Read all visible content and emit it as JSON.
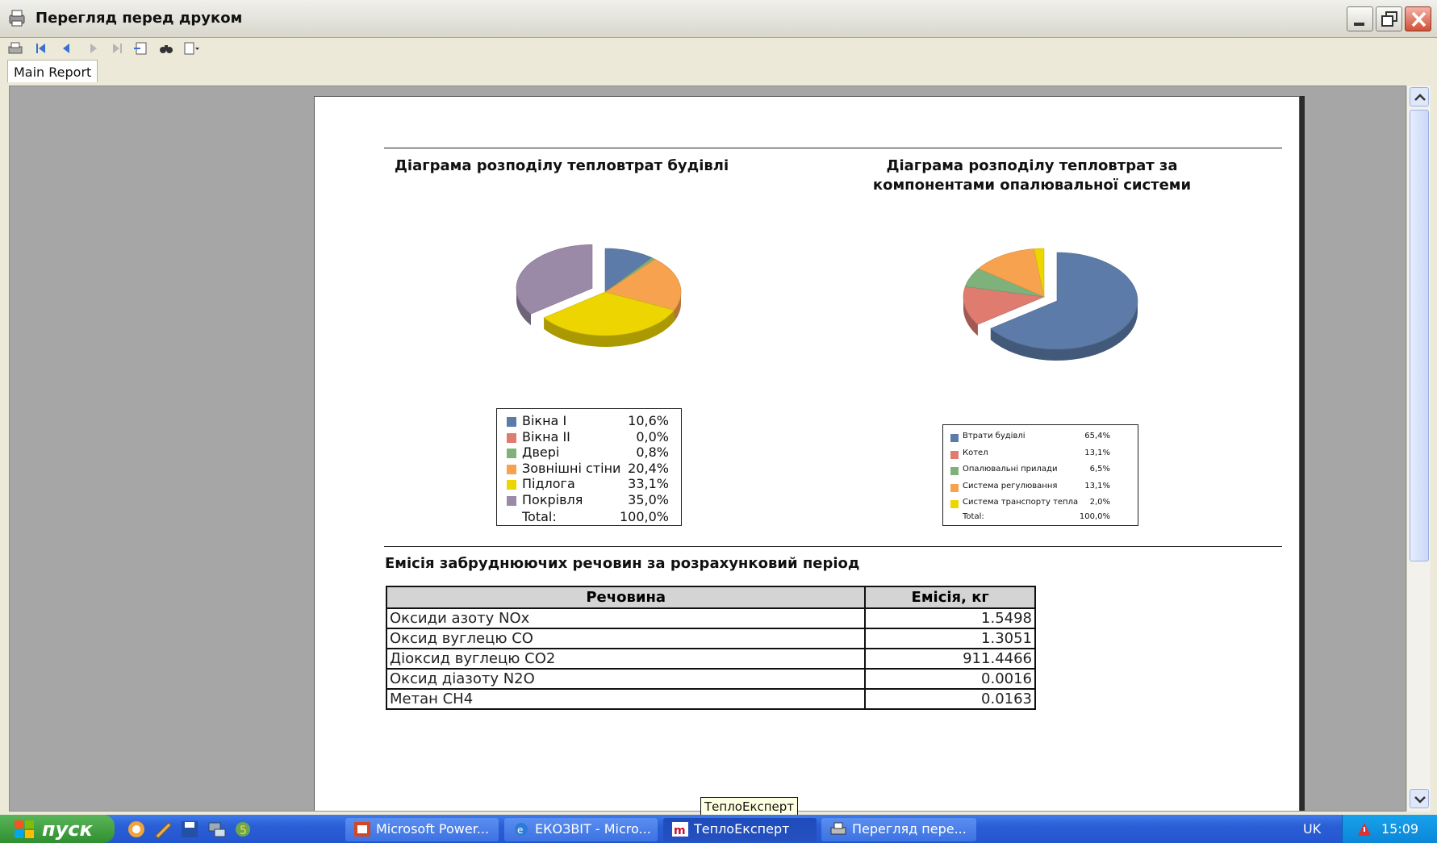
{
  "window": {
    "title": "Перегляд перед друком"
  },
  "tabs": [
    {
      "label": "Main Report"
    }
  ],
  "report": {
    "chart1": {
      "title": "Діаграма розподілу тепловтрат будівлі",
      "legend": [
        {
          "label": "Вікна I",
          "value": "10,6%",
          "color": "#5d7ba8"
        },
        {
          "label": "Вікна II",
          "value": "0,0%",
          "color": "#e07b70"
        },
        {
          "label": "Двері",
          "value": "0,8%",
          "color": "#7fb27a"
        },
        {
          "label": "Зовнішні стіни",
          "value": "20,4%",
          "color": "#f6a24f"
        },
        {
          "label": "Підлога",
          "value": "33,1%",
          "color": "#ecd500"
        },
        {
          "label": "Покрівля",
          "value": "35,0%",
          "color": "#9a8aa8"
        }
      ],
      "total_label": "Total:",
      "total_value": "100,0%"
    },
    "chart2": {
      "title_line1": "Діаграма розподілу тепловтрат за",
      "title_line2": "компонентами опалювальної системи",
      "legend": [
        {
          "label": "Втрати будівлі",
          "value": "65,4%",
          "color": "#5d7ba8"
        },
        {
          "label": "Котел",
          "value": "13,1%",
          "color": "#e07b70"
        },
        {
          "label": "Опалювальні прилади",
          "value": "6,5%",
          "color": "#7fb27a"
        },
        {
          "label": "Система регулювання",
          "value": "13,1%",
          "color": "#f6a24f"
        },
        {
          "label": "Система транспорту тепла",
          "value": "2,0%",
          "color": "#ecd500"
        }
      ],
      "total_label": "Total:",
      "total_value": "100,0%"
    },
    "emission": {
      "title": "Емісія забруднюючих речовин за розрахунковий період",
      "header_substance": "Речовина",
      "header_emission": "Емісія, кг",
      "rows": [
        {
          "substance": "Оксиди азоту NOx",
          "emission": "1.5498"
        },
        {
          "substance": "Оксид вуглецю CO",
          "emission": "1.3051"
        },
        {
          "substance": "Діоксид вуглецю CO2",
          "emission": "911.4466"
        },
        {
          "substance": "Оксид діазоту N2O",
          "emission": "0.0016"
        },
        {
          "substance": "Метан CH4",
          "emission": "0.0163"
        }
      ]
    }
  },
  "chart_data": [
    {
      "type": "pie",
      "title": "Діаграма розподілу тепловтрат будівлі",
      "categories": [
        "Вікна I",
        "Вікна II",
        "Двері",
        "Зовнішні стіни",
        "Підлога",
        "Покрівля"
      ],
      "values": [
        10.6,
        0.0,
        0.8,
        20.4,
        33.1,
        35.0
      ],
      "colors": [
        "#5d7ba8",
        "#e07b70",
        "#7fb27a",
        "#f6a24f",
        "#ecd500",
        "#9a8aa8"
      ],
      "exploded": "Покрівля",
      "legend": "below"
    },
    {
      "type": "pie",
      "title": "Діаграма розподілу тепловтрат за компонентами опалювальної системи",
      "categories": [
        "Втрати будівлі",
        "Котел",
        "Опалювальні прилади",
        "Система регулювання",
        "Система транспорту тепла"
      ],
      "values": [
        65.4,
        13.1,
        6.5,
        13.1,
        2.0
      ],
      "colors": [
        "#5d7ba8",
        "#e07b70",
        "#7fb27a",
        "#f6a24f",
        "#ecd500"
      ],
      "exploded": "Втрати будівлі",
      "legend": "below"
    }
  ],
  "tooltip": {
    "text": "ТеплоЕксперт"
  },
  "taskbar": {
    "start_label": "пуск",
    "tasks": [
      {
        "label": "Microsoft Power..."
      },
      {
        "label": "ЕКОЗВІТ - Micro..."
      },
      {
        "label": "ТеплоЕксперт"
      },
      {
        "label": "Перегляд пере..."
      }
    ],
    "language": "UK",
    "clock": "15:09"
  }
}
